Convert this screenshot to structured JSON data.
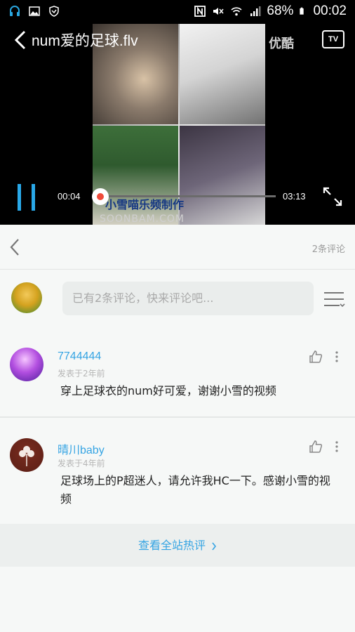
{
  "status_bar": {
    "battery": "68%",
    "time": "00:02"
  },
  "player": {
    "title": "num爱的足球.flv",
    "brand": "优酷",
    "tv_label": "TV",
    "current_time": "00:04",
    "total_time": "03:13",
    "progress": 0.02,
    "watermark_text": "小雪喵乐频制作",
    "watermark_domain": "SOONBAM.COM"
  },
  "comments_header": {
    "count_label": "2条评论"
  },
  "composer": {
    "placeholder": "已有2条评论，快来评论吧..."
  },
  "comments": [
    {
      "username": "7744444",
      "time": "发表于2年前",
      "text": "穿上足球衣的num好可爱，谢谢小雪的视频"
    },
    {
      "username": "晴川baby",
      "time": "发表于4年前",
      "text": "足球场上的P超迷人，请允许我HC一下。感谢小雪的视频"
    }
  ],
  "footer": {
    "hot_label": "查看全站热评"
  },
  "colors": {
    "accent": "#35a4e3",
    "progress": "#ef4b3b",
    "pause": "#29a8e8"
  }
}
